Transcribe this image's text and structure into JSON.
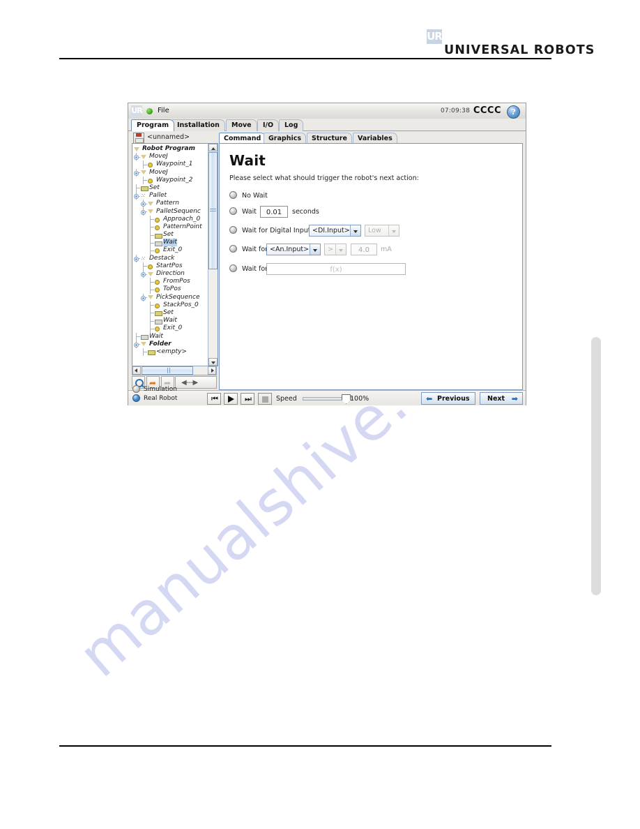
{
  "page": {
    "logo_mark": "UR",
    "logo_text": "UNIVERSAL ROBOTS",
    "watermark": "manualshive.com"
  },
  "pendant": {
    "titlebar": {
      "logo": "UR",
      "file_menu": "File",
      "time": "07:09:38",
      "robot_name": "CCCC",
      "help": "?"
    },
    "tabs": [
      {
        "label": "Program",
        "active": true
      },
      {
        "label": "Installation",
        "active": false
      },
      {
        "label": "Move",
        "active": false
      },
      {
        "label": "I/O",
        "active": false
      },
      {
        "label": "Log",
        "active": false
      }
    ],
    "subtabs": [
      {
        "label": "Command",
        "active": true
      },
      {
        "label": "Graphics",
        "active": false
      },
      {
        "label": "Structure",
        "active": false
      },
      {
        "label": "Variables",
        "active": false
      }
    ],
    "file": {
      "name": "<unnamed>"
    },
    "tree": [
      {
        "label": "Robot Program",
        "indent": 0,
        "icon": "twisty",
        "bold": true,
        "selected": false
      },
      {
        "label": "MoveJ",
        "indent": 1,
        "icon": "twisty",
        "bold": false,
        "selected": false
      },
      {
        "label": "Waypoint_1",
        "indent": 2,
        "icon": "dot",
        "bold": false,
        "selected": false
      },
      {
        "label": "MoveJ",
        "indent": 1,
        "icon": "twisty",
        "bold": false,
        "selected": false
      },
      {
        "label": "Waypoint_2",
        "indent": 2,
        "icon": "dot",
        "bold": false,
        "selected": false
      },
      {
        "label": "Set",
        "indent": 1,
        "icon": "chip",
        "bold": false,
        "selected": false
      },
      {
        "label": "Pallet",
        "indent": 1,
        "icon": "pallet",
        "bold": false,
        "selected": false
      },
      {
        "label": "Pattern",
        "indent": 2,
        "icon": "twisty",
        "bold": false,
        "selected": false
      },
      {
        "label": "PalletSequenc",
        "indent": 2,
        "icon": "twisty",
        "bold": false,
        "selected": false
      },
      {
        "label": "Approach_0",
        "indent": 3,
        "icon": "dot",
        "bold": false,
        "selected": false
      },
      {
        "label": "PatternPoint",
        "indent": 3,
        "icon": "dot",
        "bold": false,
        "selected": false
      },
      {
        "label": "Set",
        "indent": 3,
        "icon": "chip",
        "bold": false,
        "selected": false
      },
      {
        "label": "Wait",
        "indent": 3,
        "icon": "chipgray",
        "bold": false,
        "selected": true
      },
      {
        "label": "Exit_0",
        "indent": 3,
        "icon": "dot",
        "bold": false,
        "selected": false
      },
      {
        "label": "Destack",
        "indent": 1,
        "icon": "pallet",
        "bold": false,
        "selected": false
      },
      {
        "label": "StartPos",
        "indent": 2,
        "icon": "dot",
        "bold": false,
        "selected": false
      },
      {
        "label": "Direction",
        "indent": 2,
        "icon": "twisty",
        "bold": false,
        "selected": false
      },
      {
        "label": "FromPos",
        "indent": 3,
        "icon": "dot",
        "bold": false,
        "selected": false
      },
      {
        "label": "ToPos",
        "indent": 3,
        "icon": "dot",
        "bold": false,
        "selected": false
      },
      {
        "label": "PickSequence",
        "indent": 2,
        "icon": "twisty",
        "bold": false,
        "selected": false
      },
      {
        "label": "StackPos_0",
        "indent": 3,
        "icon": "dot",
        "bold": false,
        "selected": false
      },
      {
        "label": "Set",
        "indent": 3,
        "icon": "chip",
        "bold": false,
        "selected": false
      },
      {
        "label": "Wait",
        "indent": 3,
        "icon": "chipgray",
        "bold": false,
        "selected": false
      },
      {
        "label": "Exit_0",
        "indent": 3,
        "icon": "dot",
        "bold": false,
        "selected": false
      },
      {
        "label": "Wait",
        "indent": 1,
        "icon": "chipgray",
        "bold": false,
        "selected": false
      },
      {
        "label": "Folder",
        "indent": 1,
        "icon": "twisty",
        "bold": true,
        "selected": false
      },
      {
        "label": "<empty>",
        "indent": 2,
        "icon": "chip",
        "bold": false,
        "selected": false
      }
    ],
    "tools": {
      "search_icon": "search-icon",
      "undo_icon": "undo-icon",
      "redo_icon": "redo-icon",
      "move_icon": "move-left-right-icon"
    },
    "command": {
      "title": "Wait",
      "subtitle": "Please select what should trigger the robot's next action:",
      "options": [
        {
          "label": "No Wait"
        },
        {
          "label": "Wait",
          "value": "0.01",
          "unit": "seconds"
        },
        {
          "label": "Wait for Digital Input",
          "select": "<DI.Input>",
          "select2": "Low"
        },
        {
          "label": "Wait for",
          "select": "<An.Input>",
          "op": ">",
          "value": "4.0",
          "unit": "mA"
        },
        {
          "label": "Wait for",
          "expr_placeholder": "f(x)"
        }
      ]
    },
    "bottom": {
      "simulation": "Simulation",
      "real_robot": "Real Robot",
      "speed_label": "Speed",
      "speed_value": "100%",
      "previous": "Previous",
      "next": "Next",
      "buttons": {
        "rewind": "⏮",
        "play": "play-icon",
        "step": "⏭",
        "stop": "stop-icon"
      }
    }
  }
}
